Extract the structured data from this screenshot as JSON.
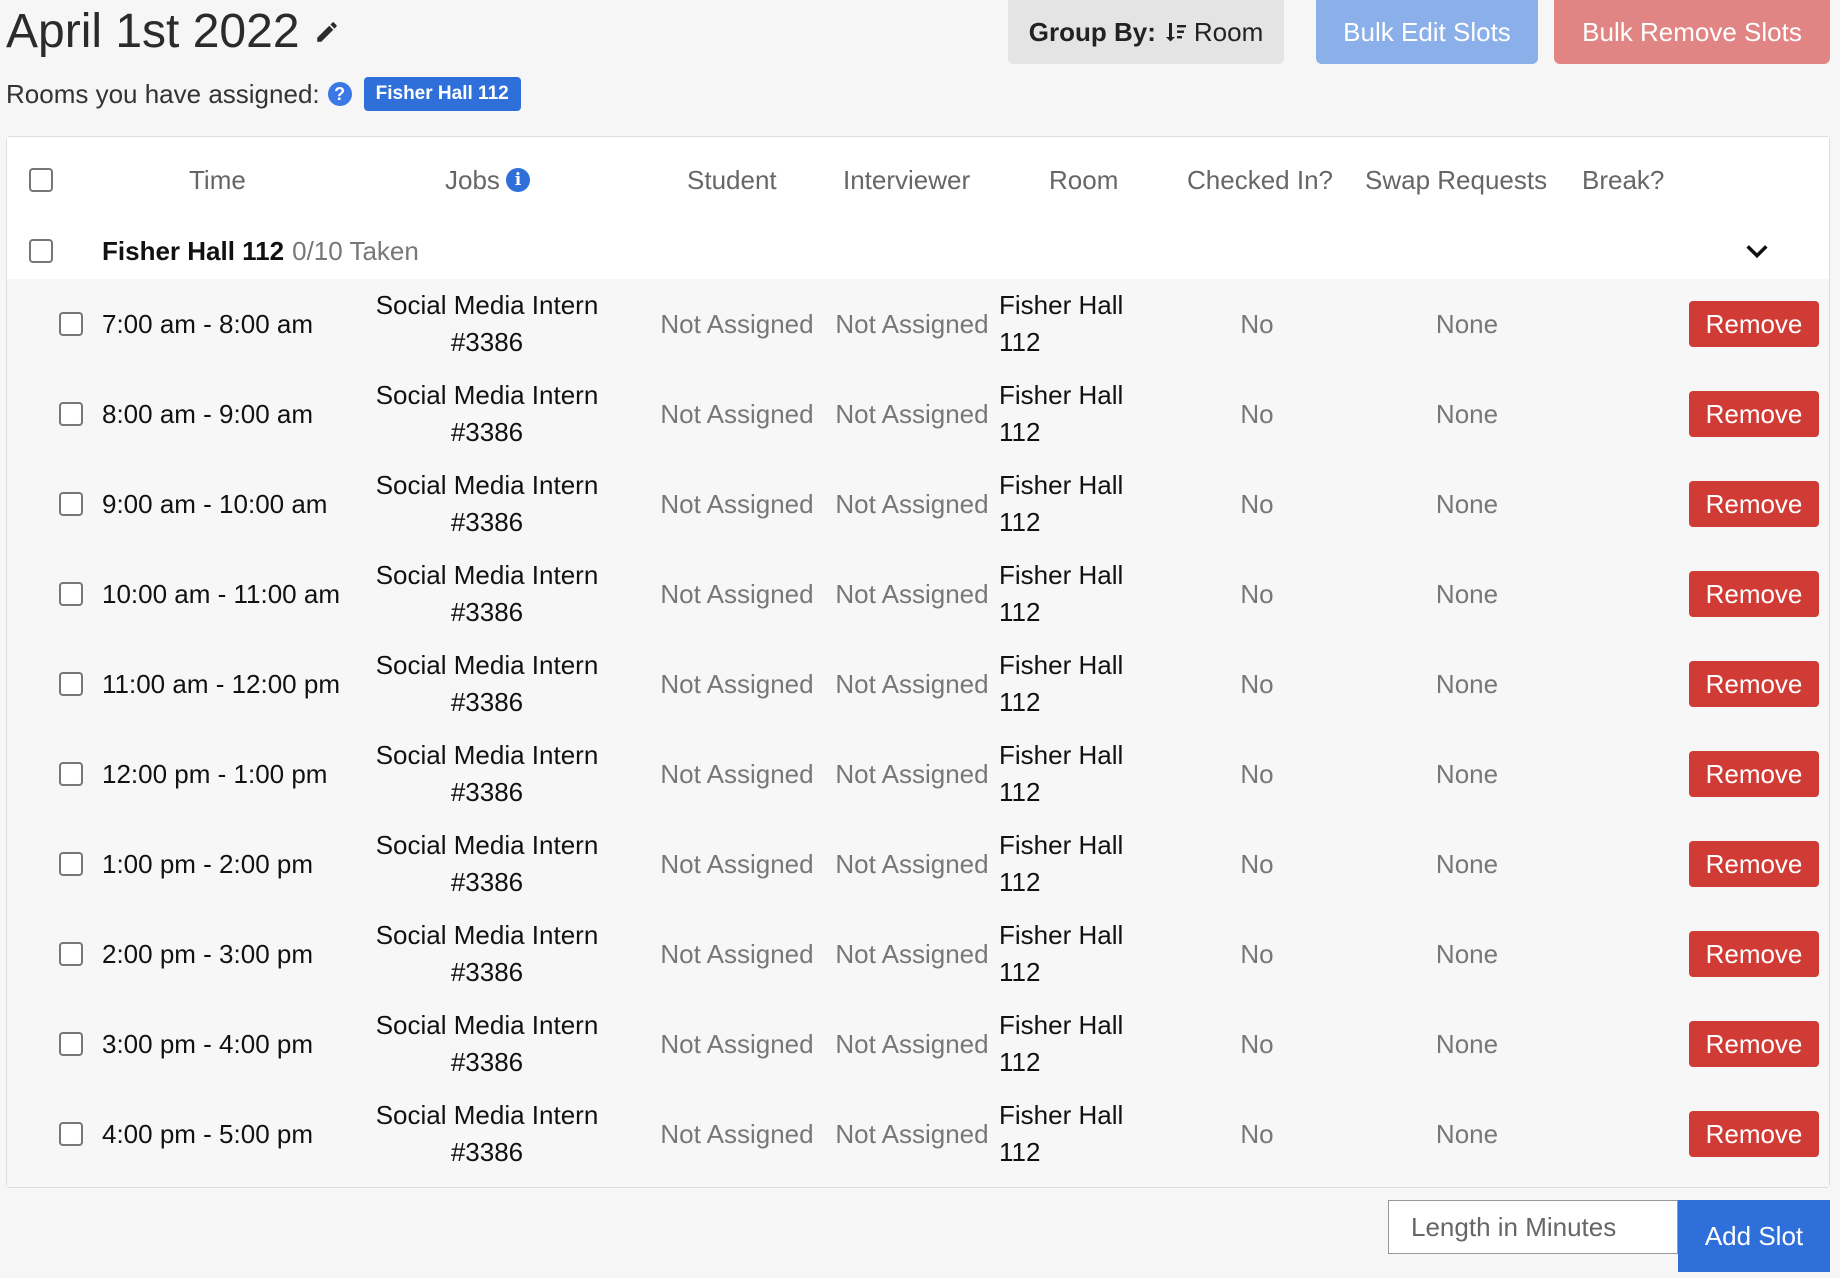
{
  "header": {
    "title": "April 1st 2022",
    "rooms_label": "Rooms you have assigned:",
    "room_badge": "Fisher Hall 112",
    "group_by_label": "Group By:",
    "group_by_value": "Room",
    "bulk_edit_label": "Bulk Edit Slots",
    "bulk_remove_label": "Bulk Remove Slots"
  },
  "table": {
    "columns": [
      "Time",
      "Jobs",
      "Student",
      "Interviewer",
      "Room",
      "Checked In?",
      "Swap Requests",
      "Break?"
    ],
    "group": {
      "name": "Fisher Hall 112",
      "taken": "0/10 Taken"
    },
    "rows": [
      {
        "time": "7:00 am - 8:00 am",
        "job": "Social Media Intern #3386",
        "student": "Not Assigned",
        "interviewer": "Not Assigned",
        "room": "Fisher Hall 112",
        "checked_in": "No",
        "swap": "None",
        "action": "Remove"
      },
      {
        "time": "8:00 am - 9:00 am",
        "job": "Social Media Intern #3386",
        "student": "Not Assigned",
        "interviewer": "Not Assigned",
        "room": "Fisher Hall 112",
        "checked_in": "No",
        "swap": "None",
        "action": "Remove"
      },
      {
        "time": "9:00 am - 10:00 am",
        "job": "Social Media Intern #3386",
        "student": "Not Assigned",
        "interviewer": "Not Assigned",
        "room": "Fisher Hall 112",
        "checked_in": "No",
        "swap": "None",
        "action": "Remove"
      },
      {
        "time": "10:00 am - 11:00 am",
        "job": "Social Media Intern #3386",
        "student": "Not Assigned",
        "interviewer": "Not Assigned",
        "room": "Fisher Hall 112",
        "checked_in": "No",
        "swap": "None",
        "action": "Remove"
      },
      {
        "time": "11:00 am - 12:00 pm",
        "job": "Social Media Intern #3386",
        "student": "Not Assigned",
        "interviewer": "Not Assigned",
        "room": "Fisher Hall 112",
        "checked_in": "No",
        "swap": "None",
        "action": "Remove"
      },
      {
        "time": "12:00 pm - 1:00 pm",
        "job": "Social Media Intern #3386",
        "student": "Not Assigned",
        "interviewer": "Not Assigned",
        "room": "Fisher Hall 112",
        "checked_in": "No",
        "swap": "None",
        "action": "Remove"
      },
      {
        "time": "1:00 pm - 2:00 pm",
        "job": "Social Media Intern #3386",
        "student": "Not Assigned",
        "interviewer": "Not Assigned",
        "room": "Fisher Hall 112",
        "checked_in": "No",
        "swap": "None",
        "action": "Remove"
      },
      {
        "time": "2:00 pm - 3:00 pm",
        "job": "Social Media Intern #3386",
        "student": "Not Assigned",
        "interviewer": "Not Assigned",
        "room": "Fisher Hall 112",
        "checked_in": "No",
        "swap": "None",
        "action": "Remove"
      },
      {
        "time": "3:00 pm - 4:00 pm",
        "job": "Social Media Intern #3386",
        "student": "Not Assigned",
        "interviewer": "Not Assigned",
        "room": "Fisher Hall 112",
        "checked_in": "No",
        "swap": "None",
        "action": "Remove"
      },
      {
        "time": "4:00 pm - 5:00 pm",
        "job": "Social Media Intern #3386",
        "student": "Not Assigned",
        "interviewer": "Not Assigned",
        "room": "Fisher Hall 112",
        "checked_in": "No",
        "swap": "None",
        "action": "Remove"
      }
    ]
  },
  "footer": {
    "length_placeholder": "Length in Minutes",
    "add_slot_label": "Add Slot"
  },
  "colors": {
    "primary": "#2f6fd9",
    "danger": "#d13b35",
    "bulk_edit": "#8aafe9",
    "bulk_remove": "#e08583"
  }
}
